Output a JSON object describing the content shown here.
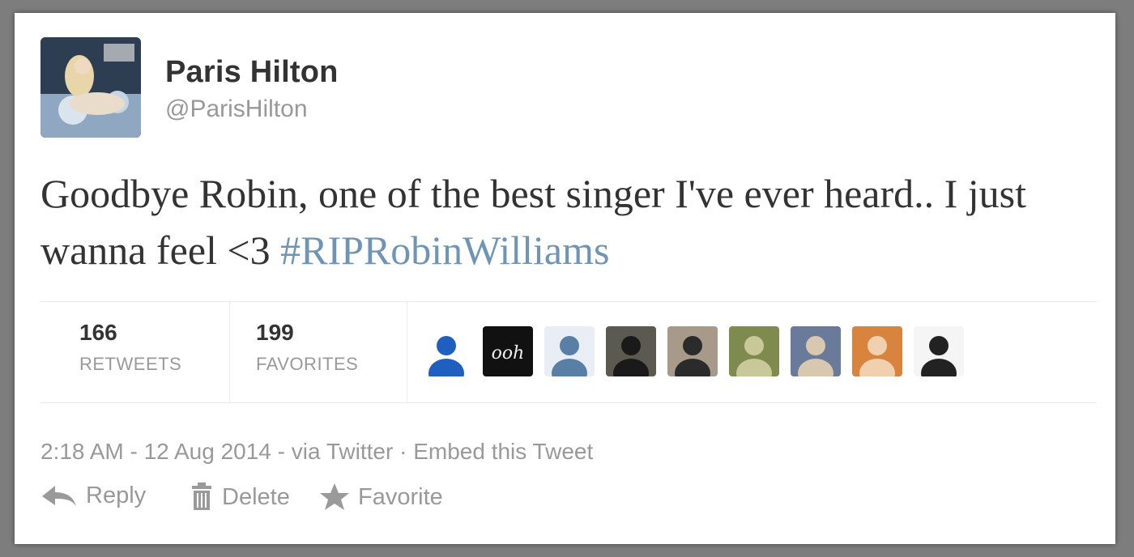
{
  "user": {
    "display_name": "Paris Hilton",
    "handle": "@ParisHilton",
    "avatar_icon": "profile-photo"
  },
  "tweet": {
    "text": "Goodbye Robin, one of the best singer I've ever heard.. I just wanna feel <3 ",
    "hashtag": "#RIPRobinWilliams"
  },
  "stats": {
    "retweets_count": "166",
    "retweets_label": "RETWEETS",
    "favorites_count": "199",
    "favorites_label": "FAVORITES"
  },
  "favoriters": [
    {
      "name": "favoriter-1",
      "colors": [
        "#ffffff",
        "#1f5fbf"
      ]
    },
    {
      "name": "favoriter-2",
      "colors": [
        "#111111",
        "#eeeeee"
      ],
      "text": "ooh"
    },
    {
      "name": "favoriter-3",
      "colors": [
        "#e9eef4",
        "#5a7fa6"
      ]
    },
    {
      "name": "favoriter-4",
      "colors": [
        "#5a5a50",
        "#1a1a1a"
      ]
    },
    {
      "name": "favoriter-5",
      "colors": [
        "#a89a88",
        "#2b2b2b"
      ]
    },
    {
      "name": "favoriter-6",
      "colors": [
        "#7f8a4e",
        "#c8c89a"
      ]
    },
    {
      "name": "favoriter-7",
      "colors": [
        "#6a7a9a",
        "#d8c8b0"
      ]
    },
    {
      "name": "favoriter-8",
      "colors": [
        "#d9843e",
        "#f1d0b0"
      ]
    },
    {
      "name": "favoriter-9",
      "colors": [
        "#f5f5f5",
        "#222222"
      ]
    }
  ],
  "meta": {
    "time": "2:18 AM - 12 Aug 2014",
    "separator1": " - ",
    "via": "via Twitter",
    "separator2": " · ",
    "embed": "Embed this Tweet"
  },
  "actions": {
    "reply": "Reply",
    "delete": "Delete",
    "favorite": "Favorite"
  },
  "colors": {
    "hashtag": "#6f95b6",
    "text": "#333333",
    "muted": "#999999"
  }
}
